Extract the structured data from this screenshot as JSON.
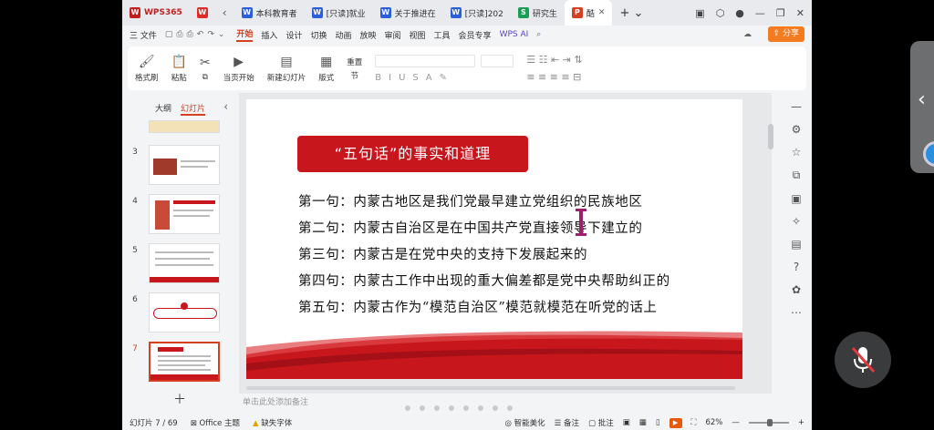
{
  "tabs": [
    {
      "label": "WPS365",
      "icon": "wps-logo-icon",
      "color": "#c21f1f"
    },
    {
      "label": "",
      "icon": "wps-red-icon",
      "color": "#e02b2b"
    },
    {
      "label": "本科教育者",
      "icon": "word-icon",
      "color": "#2b5fd9"
    },
    {
      "label": "[只读]就业",
      "icon": "word-icon",
      "color": "#2b5fd9"
    },
    {
      "label": "关于推进在",
      "icon": "word-icon",
      "color": "#2b5fd9"
    },
    {
      "label": "[只读]202",
      "icon": "word-icon",
      "color": "#2b5fd9"
    },
    {
      "label": "研究生",
      "icon": "sheet-icon",
      "color": "#1a9d55"
    },
    {
      "label": "酷",
      "icon": "ppt-icon",
      "color": "#d6401f"
    }
  ],
  "menu": [
    "三 文件",
    "开始",
    "插入",
    "设计",
    "切换",
    "动画",
    "放映",
    "审阅",
    "视图",
    "工具",
    "会员专享",
    "WPS AI"
  ],
  "active_menu": "开始",
  "share_label": "分享",
  "ribbon": {
    "format_painter": "格式刷",
    "paste": "粘贴",
    "play_from_current": "当页开始",
    "new_slide": "新建幻灯片",
    "layout": "版式",
    "section": "节",
    "reset": "重置"
  },
  "left_panel": {
    "tab_outline": "大纲",
    "tab_slides": "幻灯片",
    "slides": [
      {
        "num": "3"
      },
      {
        "num": "4"
      },
      {
        "num": "5"
      },
      {
        "num": "6"
      },
      {
        "num": "7"
      }
    ],
    "selected": "7"
  },
  "slide": {
    "title": "“五句话”的事实和道理",
    "lines": [
      "第一句：内蒙古地区是我们党最早建立党组织的民族地区",
      "第二句：内蒙古自治区是在中国共产党直接领导下建立的",
      "第三句：内蒙古是在党中央的支持下发展起来的",
      "第四句：内蒙古工作中出现的重大偏差都是党中央帮助纠正的",
      "第五句：内蒙古作为“模范自治区”模范就模范在听党的话上"
    ],
    "accent_color": "#c8161d"
  },
  "notes_placeholder": "单击此处添加备注",
  "status": {
    "slide_counter": "幻灯片 7 / 69",
    "theme": "Office 主题",
    "missing_font": "缺失字体",
    "smart_beautify": "智能美化",
    "notes": "备注",
    "comments": "批注",
    "zoom": "62%"
  }
}
